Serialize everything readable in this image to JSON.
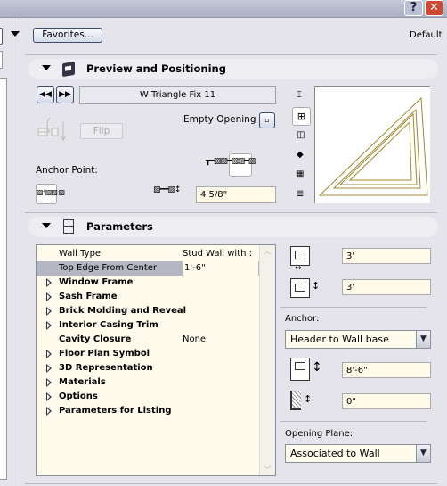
{
  "titlebar": {
    "help": "?",
    "close": "✕"
  },
  "toolbar": {
    "favorites": "Favorites...",
    "default": "Default"
  },
  "preview": {
    "title": "Preview and Positioning",
    "object_name": "W Triangle Fix 11",
    "flip": "Flip",
    "empty_opening": "Empty Opening",
    "anchor_point": "Anchor Point:",
    "offset_value": "4 5/8\"",
    "stroke_color": "#a08830"
  },
  "parameters": {
    "title": "Parameters",
    "rows": [
      {
        "name": "Wall Type",
        "value": "Stud Wall with :",
        "bold": false,
        "expand": false
      },
      {
        "name": "Top Edge From Center",
        "value": "1'-6\"",
        "bold": false,
        "expand": false,
        "selected": true
      },
      {
        "name": "Window Frame",
        "value": "",
        "bold": true,
        "expand": true
      },
      {
        "name": "Sash Frame",
        "value": "",
        "bold": true,
        "expand": true
      },
      {
        "name": "Brick Molding and Reveal",
        "value": "",
        "bold": true,
        "expand": true
      },
      {
        "name": "Interior Casing Trim",
        "value": "",
        "bold": true,
        "expand": true
      },
      {
        "name": "Cavity Closure",
        "value": "None",
        "bold": true,
        "expand": false
      },
      {
        "name": "Floor Plan Symbol",
        "value": "",
        "bold": true,
        "expand": true
      },
      {
        "name": "3D Representation",
        "value": "",
        "bold": true,
        "expand": true
      },
      {
        "name": "Materials",
        "value": "",
        "bold": true,
        "expand": true
      },
      {
        "name": "Options",
        "value": "",
        "bold": true,
        "expand": true
      },
      {
        "name": "Parameters for Listing",
        "value": "",
        "bold": true,
        "expand": true
      }
    ],
    "width": "3'",
    "height": "3'",
    "anchor_label": "Anchor:",
    "anchor_value": "Header to Wall base",
    "header_height": "8'-6\"",
    "sill_offset": "0\"",
    "plane_label": "Opening Plane:",
    "plane_value": "Associated to Wall"
  }
}
